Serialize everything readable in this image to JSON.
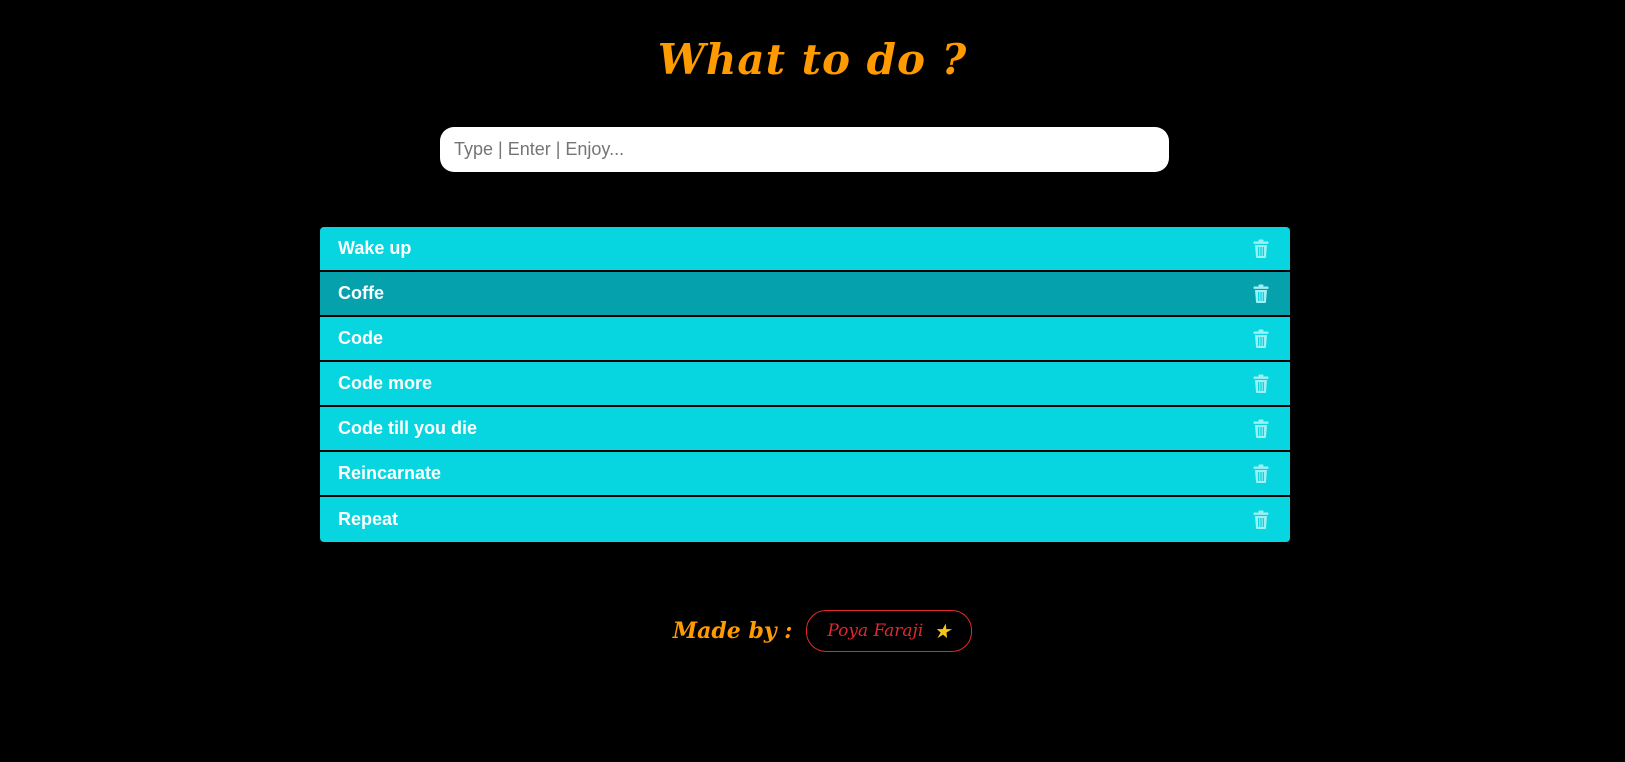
{
  "header": {
    "title": "What to do ?"
  },
  "search": {
    "placeholder": "Type | Enter | Enjoy...",
    "value": ""
  },
  "todos": [
    {
      "label": "Wake up",
      "active": false
    },
    {
      "label": "Coffe",
      "active": true
    },
    {
      "label": "Code",
      "active": false
    },
    {
      "label": "Code more",
      "active": false
    },
    {
      "label": "Code till you die",
      "active": false
    },
    {
      "label": "Reincarnate",
      "active": false
    },
    {
      "label": "Repeat",
      "active": false
    }
  ],
  "footer": {
    "made_by_label": "Made by :",
    "author_name": "Poya Faraji",
    "author_icon": "star-icon"
  },
  "colors": {
    "background": "#000000",
    "title": "#ff9a00",
    "item": "#07d5e0",
    "item_active": "#05a1ad",
    "trash_icon": "#9df0f4",
    "author_accent": "#e0292f",
    "star": "#f5c518"
  }
}
